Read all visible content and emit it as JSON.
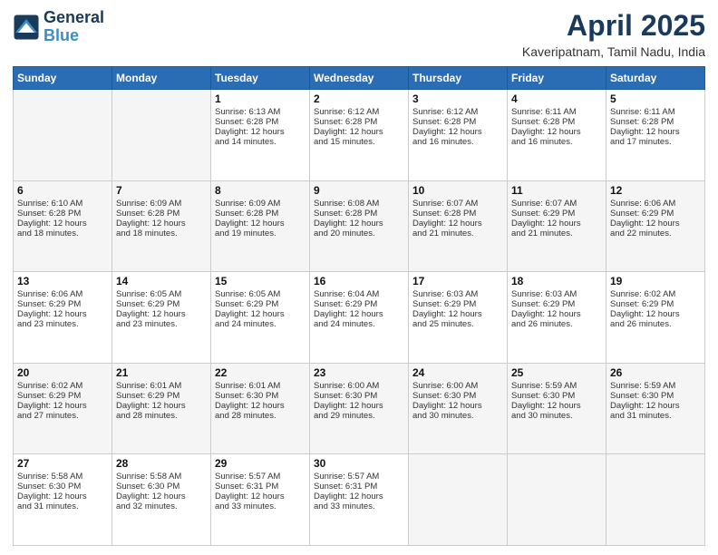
{
  "header": {
    "logo_line1": "General",
    "logo_line2": "Blue",
    "title": "April 2025",
    "subtitle": "Kaveripatnam, Tamil Nadu, India"
  },
  "calendar": {
    "days_of_week": [
      "Sunday",
      "Monday",
      "Tuesday",
      "Wednesday",
      "Thursday",
      "Friday",
      "Saturday"
    ],
    "weeks": [
      [
        {
          "day": "",
          "content": ""
        },
        {
          "day": "",
          "content": ""
        },
        {
          "day": "1",
          "content": "Sunrise: 6:13 AM\nSunset: 6:28 PM\nDaylight: 12 hours\nand 14 minutes."
        },
        {
          "day": "2",
          "content": "Sunrise: 6:12 AM\nSunset: 6:28 PM\nDaylight: 12 hours\nand 15 minutes."
        },
        {
          "day": "3",
          "content": "Sunrise: 6:12 AM\nSunset: 6:28 PM\nDaylight: 12 hours\nand 16 minutes."
        },
        {
          "day": "4",
          "content": "Sunrise: 6:11 AM\nSunset: 6:28 PM\nDaylight: 12 hours\nand 16 minutes."
        },
        {
          "day": "5",
          "content": "Sunrise: 6:11 AM\nSunset: 6:28 PM\nDaylight: 12 hours\nand 17 minutes."
        }
      ],
      [
        {
          "day": "6",
          "content": "Sunrise: 6:10 AM\nSunset: 6:28 PM\nDaylight: 12 hours\nand 18 minutes."
        },
        {
          "day": "7",
          "content": "Sunrise: 6:09 AM\nSunset: 6:28 PM\nDaylight: 12 hours\nand 18 minutes."
        },
        {
          "day": "8",
          "content": "Sunrise: 6:09 AM\nSunset: 6:28 PM\nDaylight: 12 hours\nand 19 minutes."
        },
        {
          "day": "9",
          "content": "Sunrise: 6:08 AM\nSunset: 6:28 PM\nDaylight: 12 hours\nand 20 minutes."
        },
        {
          "day": "10",
          "content": "Sunrise: 6:07 AM\nSunset: 6:28 PM\nDaylight: 12 hours\nand 21 minutes."
        },
        {
          "day": "11",
          "content": "Sunrise: 6:07 AM\nSunset: 6:29 PM\nDaylight: 12 hours\nand 21 minutes."
        },
        {
          "day": "12",
          "content": "Sunrise: 6:06 AM\nSunset: 6:29 PM\nDaylight: 12 hours\nand 22 minutes."
        }
      ],
      [
        {
          "day": "13",
          "content": "Sunrise: 6:06 AM\nSunset: 6:29 PM\nDaylight: 12 hours\nand 23 minutes."
        },
        {
          "day": "14",
          "content": "Sunrise: 6:05 AM\nSunset: 6:29 PM\nDaylight: 12 hours\nand 23 minutes."
        },
        {
          "day": "15",
          "content": "Sunrise: 6:05 AM\nSunset: 6:29 PM\nDaylight: 12 hours\nand 24 minutes."
        },
        {
          "day": "16",
          "content": "Sunrise: 6:04 AM\nSunset: 6:29 PM\nDaylight: 12 hours\nand 24 minutes."
        },
        {
          "day": "17",
          "content": "Sunrise: 6:03 AM\nSunset: 6:29 PM\nDaylight: 12 hours\nand 25 minutes."
        },
        {
          "day": "18",
          "content": "Sunrise: 6:03 AM\nSunset: 6:29 PM\nDaylight: 12 hours\nand 26 minutes."
        },
        {
          "day": "19",
          "content": "Sunrise: 6:02 AM\nSunset: 6:29 PM\nDaylight: 12 hours\nand 26 minutes."
        }
      ],
      [
        {
          "day": "20",
          "content": "Sunrise: 6:02 AM\nSunset: 6:29 PM\nDaylight: 12 hours\nand 27 minutes."
        },
        {
          "day": "21",
          "content": "Sunrise: 6:01 AM\nSunset: 6:29 PM\nDaylight: 12 hours\nand 28 minutes."
        },
        {
          "day": "22",
          "content": "Sunrise: 6:01 AM\nSunset: 6:30 PM\nDaylight: 12 hours\nand 28 minutes."
        },
        {
          "day": "23",
          "content": "Sunrise: 6:00 AM\nSunset: 6:30 PM\nDaylight: 12 hours\nand 29 minutes."
        },
        {
          "day": "24",
          "content": "Sunrise: 6:00 AM\nSunset: 6:30 PM\nDaylight: 12 hours\nand 30 minutes."
        },
        {
          "day": "25",
          "content": "Sunrise: 5:59 AM\nSunset: 6:30 PM\nDaylight: 12 hours\nand 30 minutes."
        },
        {
          "day": "26",
          "content": "Sunrise: 5:59 AM\nSunset: 6:30 PM\nDaylight: 12 hours\nand 31 minutes."
        }
      ],
      [
        {
          "day": "27",
          "content": "Sunrise: 5:58 AM\nSunset: 6:30 PM\nDaylight: 12 hours\nand 31 minutes."
        },
        {
          "day": "28",
          "content": "Sunrise: 5:58 AM\nSunset: 6:30 PM\nDaylight: 12 hours\nand 32 minutes."
        },
        {
          "day": "29",
          "content": "Sunrise: 5:57 AM\nSunset: 6:31 PM\nDaylight: 12 hours\nand 33 minutes."
        },
        {
          "day": "30",
          "content": "Sunrise: 5:57 AM\nSunset: 6:31 PM\nDaylight: 12 hours\nand 33 minutes."
        },
        {
          "day": "",
          "content": ""
        },
        {
          "day": "",
          "content": ""
        },
        {
          "day": "",
          "content": ""
        }
      ]
    ]
  }
}
